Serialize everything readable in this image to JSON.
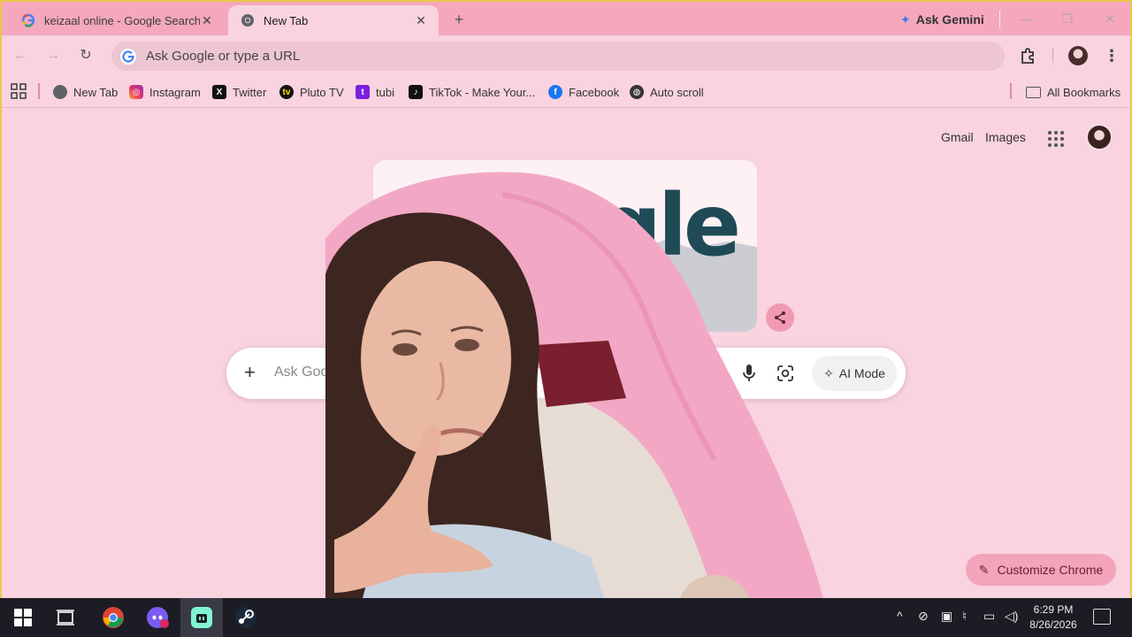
{
  "tabs": [
    {
      "title": "keizaal online - Google Search",
      "favicon": "google-g-icon",
      "active": false
    },
    {
      "title": "New Tab",
      "favicon": "chrome-icon",
      "active": true
    }
  ],
  "tabstrip": {
    "new_tab_symbol": "+",
    "gemini_label": "Ask Gemini"
  },
  "window_controls": {
    "minimize": "—",
    "restore": "❐",
    "close": "✕"
  },
  "toolbar": {
    "back": "←",
    "forward": "→",
    "reload": "↻",
    "omnibox_placeholder": "Ask Google or type a URL",
    "menu": "⋮"
  },
  "bookmarks": {
    "items": [
      {
        "label": "New Tab",
        "icon": "chrome-icon"
      },
      {
        "label": "Instagram",
        "icon": "instagram-icon"
      },
      {
        "label": "Twitter",
        "icon": "x-icon"
      },
      {
        "label": "Pluto TV",
        "icon": "pluto-tv-icon"
      },
      {
        "label": "tubi",
        "icon": "tubi-icon"
      },
      {
        "label": "TikTok - Make Your...",
        "icon": "tiktok-icon"
      },
      {
        "label": "Facebook",
        "icon": "facebook-icon"
      },
      {
        "label": "Auto scroll",
        "icon": "globe-icon"
      }
    ],
    "all_bookmarks": "All Bookmarks"
  },
  "newtab": {
    "gmail": "Gmail",
    "images": "Images",
    "doodle_text": "gle",
    "search_placeholder": "Ask Goo",
    "plus": "+",
    "ai_mode": "AI Mode",
    "customize": "Customize Chrome"
  },
  "taskbar": {
    "time": "6:29 PM",
    "date": "8/26/2026",
    "tray_up": "^"
  },
  "colors": {
    "tabstrip": "#f4a7bd",
    "toolbar": "#f9d3df",
    "content_bg": "#f9d3df",
    "accent_pink": "#f3a3ba",
    "taskbar": "#1c1c24"
  }
}
